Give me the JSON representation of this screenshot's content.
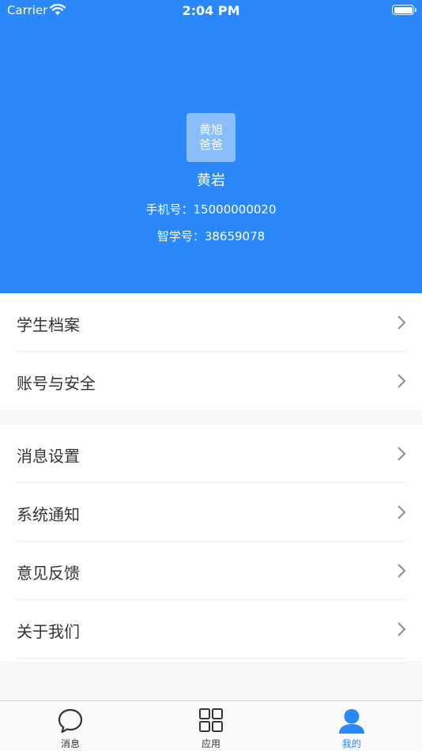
{
  "status_bar": {
    "carrier": "Carrier",
    "time": "2:04 PM"
  },
  "profile": {
    "avatar_text_line1": "黄旭",
    "avatar_text_line2": "爸爸",
    "name": "黄岩",
    "phone_label": "手机号：",
    "phone_value": "15000000020",
    "id_label": "智学号：",
    "id_value": "38659078"
  },
  "menu_group_1": [
    {
      "label": "学生档案"
    },
    {
      "label": "账号与安全"
    }
  ],
  "menu_group_2": [
    {
      "label": "消息设置"
    },
    {
      "label": "系统通知"
    },
    {
      "label": "意见反馈"
    },
    {
      "label": "关于我们"
    }
  ],
  "tabbar": {
    "tabs": [
      {
        "label": "消息",
        "icon": "chat-bubble-icon",
        "active": false
      },
      {
        "label": "应用",
        "icon": "grid-icon",
        "active": false
      },
      {
        "label": "我的",
        "icon": "person-icon",
        "active": true
      }
    ]
  },
  "colors": {
    "primary": "#2b88fa",
    "background": "#f7f7f7",
    "text": "#333333"
  }
}
